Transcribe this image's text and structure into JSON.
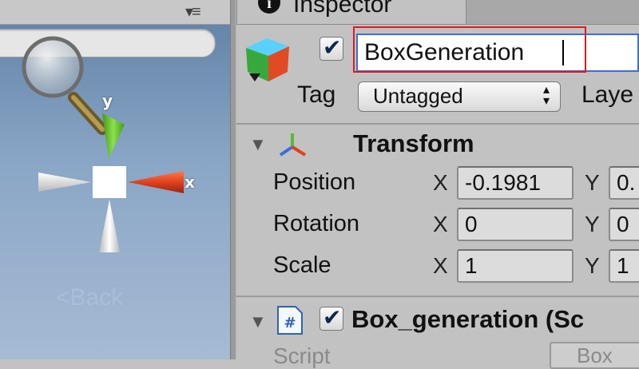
{
  "scene": {
    "axis_x_label": "x",
    "axis_y_label": "y",
    "back_label": "Back",
    "menu_glyph": "▾≡"
  },
  "inspector": {
    "tab_label": "Inspector",
    "object_name": "BoxGeneration",
    "object_active": true,
    "tag_label": "Tag",
    "tag_value": "Untagged",
    "layer_label": "Laye"
  },
  "transform": {
    "title": "Transform",
    "position": {
      "label": "Position",
      "x": "-0.1981",
      "y": "0."
    },
    "rotation": {
      "label": "Rotation",
      "x": "0",
      "y": "0"
    },
    "scale": {
      "label": "Scale",
      "x": "1",
      "y": "1"
    },
    "x_axis": "X",
    "y_axis": "Y"
  },
  "script_component": {
    "title": "Box_generation (Sc",
    "enabled": true,
    "script_label": "Script",
    "script_value": "Box"
  },
  "colors": {
    "highlight": "#e0191f",
    "name_field_border": "#3d6ed6",
    "x_axis": "#e0421e",
    "y_axis": "#78c43a",
    "z_axis": "#3b6fd9"
  }
}
